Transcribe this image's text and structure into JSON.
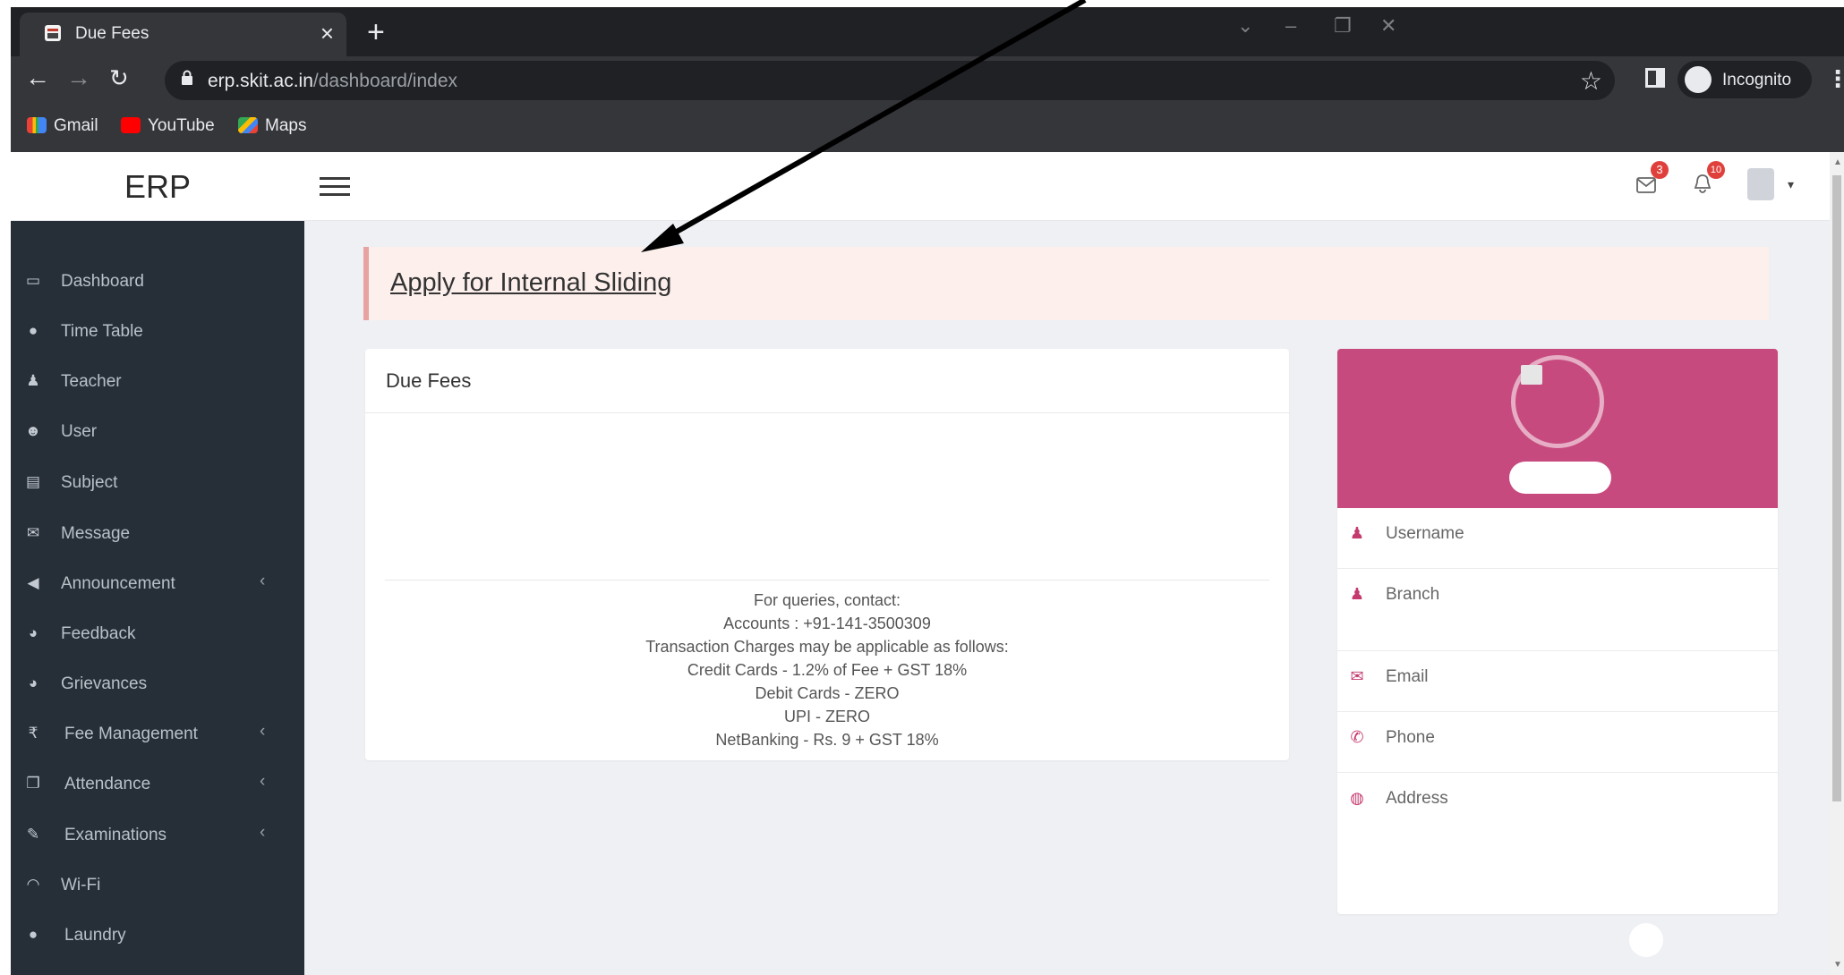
{
  "browser": {
    "tab_title": "Due Fees",
    "tab_close": "×",
    "new_tab": "+",
    "url_host": "erp.skit.ac.in",
    "url_path": "/dashboard/index",
    "profile_label": "Incognito",
    "bookmarks": [
      "Gmail",
      "YouTube",
      "Maps"
    ]
  },
  "header": {
    "brand": "ERP",
    "mail_badge": "3",
    "bell_badge": "10"
  },
  "sidebar": {
    "items": [
      {
        "label": "Dashboard",
        "icon": "laptop-icon",
        "glyph": "▭",
        "expandable": false
      },
      {
        "label": "Time Table",
        "icon": "clock-icon",
        "glyph": "●",
        "expandable": false
      },
      {
        "label": "Teacher",
        "icon": "teacher-icon",
        "glyph": "♟",
        "expandable": false
      },
      {
        "label": "User",
        "icon": "users-icon",
        "glyph": "☻",
        "expandable": false
      },
      {
        "label": "Subject",
        "icon": "book-icon",
        "glyph": "▤",
        "expandable": false
      },
      {
        "label": "Message",
        "icon": "envelope-icon",
        "glyph": "✉",
        "expandable": false
      },
      {
        "label": "Announcement",
        "icon": "bullhorn-icon",
        "glyph": "◀",
        "expandable": true
      },
      {
        "label": "Feedback",
        "icon": "comments-icon",
        "glyph": "◕",
        "expandable": false
      },
      {
        "label": "Grievances",
        "icon": "comments-icon",
        "glyph": "◕",
        "expandable": false
      },
      {
        "label": "Fee Management",
        "icon": "rupee-icon",
        "glyph": "₹",
        "expandable": true
      },
      {
        "label": "Attendance",
        "icon": "copy-icon",
        "glyph": "❐",
        "expandable": true
      },
      {
        "label": "Examinations",
        "icon": "edit-icon",
        "glyph": "✎",
        "expandable": true
      },
      {
        "label": "Wi-Fi",
        "icon": "wifi-icon",
        "glyph": "◠",
        "expandable": false
      },
      {
        "label": "Laundry",
        "icon": "laundry-icon",
        "glyph": "●",
        "expandable": false
      }
    ],
    "chevron": "‹"
  },
  "alert": {
    "link": "Apply for Internal Sliding"
  },
  "fees_card": {
    "title": "Due Fees",
    "info_lines": [
      "For queries, contact:",
      "Accounts  : +91-141-3500309",
      "Transaction Charges may be applicable as follows:",
      "Credit Cards - 1.2% of Fee + GST 18%",
      "Debit Cards - ZERO",
      "UPI - ZERO",
      "NetBanking - Rs. 9 + GST 18%"
    ]
  },
  "profile_card": {
    "accent": "#c74a7e",
    "fields": [
      {
        "label": "Username",
        "icon": "user-icon",
        "glyph": "♟"
      },
      {
        "label": "Branch",
        "icon": "user-icon",
        "glyph": "♟"
      },
      {
        "label": "Email",
        "icon": "envelope-icon",
        "glyph": "✉"
      },
      {
        "label": "Phone",
        "icon": "phone-icon",
        "glyph": "✆"
      },
      {
        "label": "Address",
        "icon": "globe-icon",
        "glyph": "◍"
      }
    ]
  },
  "colors": {
    "sidebar_bg": "#262e38",
    "alert_bg": "#fcefec",
    "badge": "#e0403c"
  }
}
